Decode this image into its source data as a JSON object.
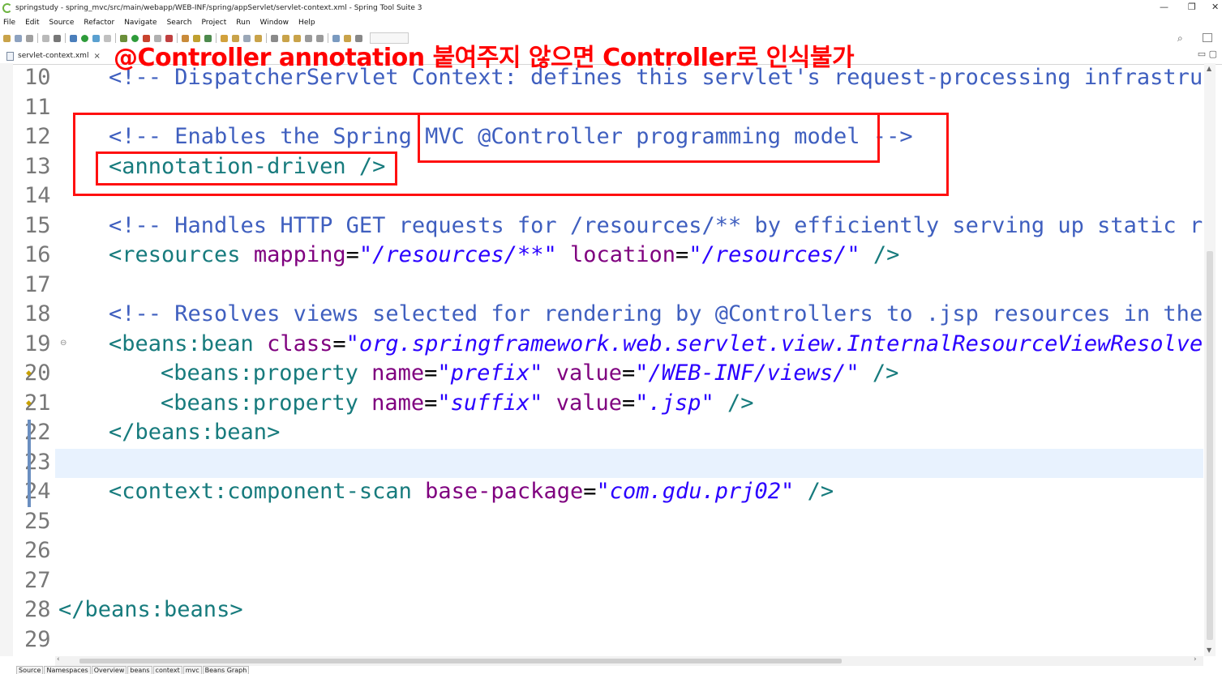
{
  "window": {
    "title": "springstudy - spring_mvc/src/main/webapp/WEB-INF/spring/appServlet/servlet-context.xml - Spring Tool Suite 3",
    "minimize": "—",
    "restore": "❐",
    "close": "✕"
  },
  "menu": [
    "File",
    "Edit",
    "Source",
    "Refactor",
    "Navigate",
    "Search",
    "Project",
    "Run",
    "Window",
    "Help"
  ],
  "tabs": {
    "active": "servlet-context.xml",
    "close_glyph": "×"
  },
  "annotation_text": "@Controller annotation 붙여주지 않으면 Controller로 인식불가",
  "editor": {
    "line_numbers": [
      "10",
      "11",
      "12",
      "13",
      "14",
      "15",
      "16",
      "17",
      "18",
      "19",
      "20",
      "21",
      "22",
      "23",
      "24",
      "25",
      "26",
      "27",
      "28",
      "29"
    ],
    "lines": {
      "l10": "<!-- DispatcherServlet Context: defines this servlet's request-processing infrastruct",
      "l12": "<!-- Enables the Spring MVC @Controller programming model -->",
      "l13": "<annotation-driven />",
      "l15": "<!-- Handles HTTP GET requests for /resources/** by efficiently serving up static res",
      "l16": {
        "open": "<resources ",
        "attr1": "mapping",
        "val1": "\"/resources/**\"",
        "attr2": "location",
        "val2": "\"/resources/\"",
        "close": " />"
      },
      "l18": "<!-- Resolves views selected for rendering by @Controllers to .jsp resources in the /",
      "l19": {
        "open": "<beans:bean ",
        "attr1": "class",
        "val1": "\"org.springframework.web.servlet.view.InternalResourceViewResolver\""
      },
      "l20": {
        "open": "<beans:property ",
        "attr1": "name",
        "val1": "\"prefix\"",
        "attr2": "value",
        "val2": "\"/WEB-INF/views/\"",
        "close": " />"
      },
      "l21": {
        "open": "<beans:property ",
        "attr1": "name",
        "val1": "\"suffix\"",
        "attr2": "value",
        "val2": "\".jsp\"",
        "close": " />"
      },
      "l22": "</beans:bean>",
      "l24": {
        "open": "<context:component-scan ",
        "attr1": "base-package",
        "val1": "\"com.gdu.prj02\"",
        "close": " />"
      },
      "l28": "</beans:beans>"
    }
  },
  "bottom_tabs": [
    "Source",
    "Namespaces",
    "Overview",
    "beans",
    "context",
    "mvc",
    "Beans Graph"
  ],
  "colors": {
    "comment": "#3f5fbf",
    "tag": "#177b7d",
    "attribute": "#7f007f",
    "string": "#2a00ff",
    "annotation": "#ff0000",
    "highlight_box": "#ff1010"
  }
}
